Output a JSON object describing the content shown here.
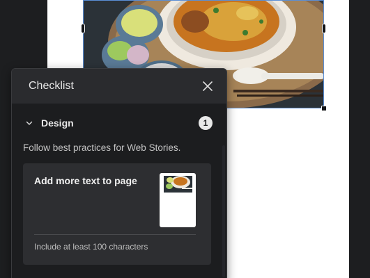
{
  "checklist": {
    "title": "Checklist",
    "section": {
      "title": "Design",
      "count": "1",
      "description": "Follow best practices for Web Stories.",
      "card": {
        "title": "Add more text to page",
        "help": "Include at least 100 characters"
      }
    }
  },
  "colors": {
    "selection": "#5b8fd6",
    "panel_bg": "#1c1d1f",
    "panel_header_bg": "#2a2b2e",
    "card_bg": "#2d2e31",
    "canvas_bg": "#ffffff",
    "workspace_bg": "#1d1e20"
  },
  "icons": {
    "close": "close-icon",
    "chevron": "chevron-down-icon"
  }
}
